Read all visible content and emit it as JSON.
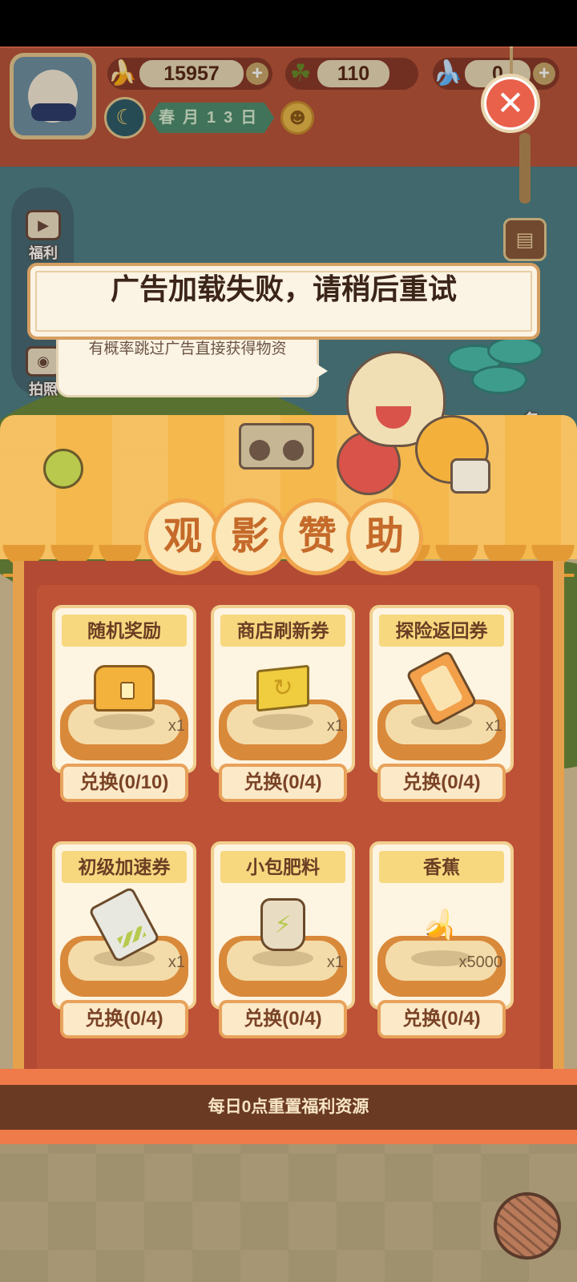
{
  "hud": {
    "bananas": "15957",
    "clovers": "110",
    "blue_bananas": "0",
    "date_text": "春月13日"
  },
  "side_menu": {
    "welfare_label": "福利",
    "photo_label": "拍照"
  },
  "right_menu": {
    "tasks_label": "务"
  },
  "bubble_text": "有概率跳过广告直接获得物资",
  "toast_text": "广告加载失败，请稍后重试",
  "panel": {
    "title_chars": [
      "观",
      "影",
      "赞",
      "助"
    ],
    "items": [
      {
        "name": "随机奖励",
        "qty": "x1",
        "icon": "treasure-chest-icon",
        "button": "兑换(0/10)"
      },
      {
        "name": "商店刷新券",
        "qty": "x1",
        "icon": "refresh-flag-icon",
        "button": "兑换(0/4)"
      },
      {
        "name": "探险返回券",
        "qty": "x1",
        "icon": "adventure-ticket-icon",
        "button": "兑换(0/4)"
      },
      {
        "name": "初级加速券",
        "qty": "x1",
        "icon": "speedup-ticket-icon",
        "button": "兑换(0/4)"
      },
      {
        "name": "小包肥料",
        "qty": "x1",
        "icon": "fertilizer-bag-icon",
        "button": "兑换(0/4)"
      },
      {
        "name": "香蕉",
        "qty": "x5000",
        "icon": "banana-icon",
        "button": "兑换(0/4)"
      }
    ],
    "footer_notice": "每日0点重置福利资源"
  },
  "colors": {
    "hud_red": "#b9553a",
    "panel_red": "#b24a34",
    "accent_orange": "#f0a54c",
    "close_red": "#e9614b"
  }
}
